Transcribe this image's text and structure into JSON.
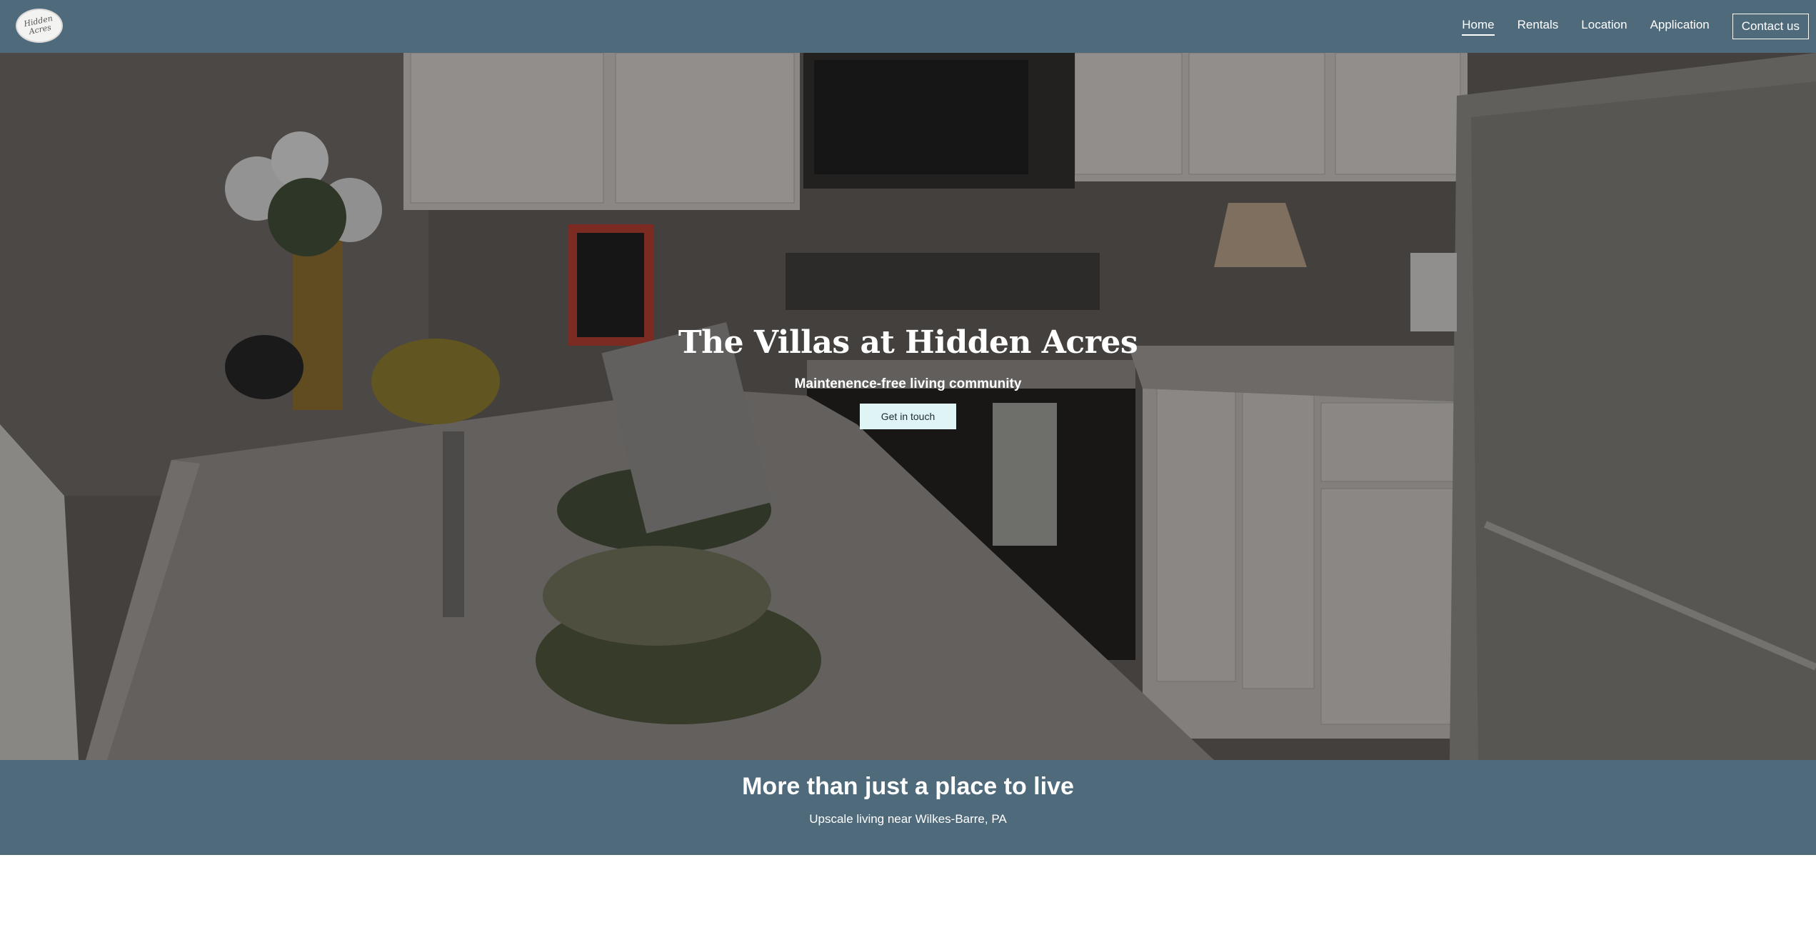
{
  "nav": {
    "logo_text": "Hidden Acres",
    "links": [
      {
        "label": "Home",
        "active": true
      },
      {
        "label": "Rentals",
        "active": false
      },
      {
        "label": "Location",
        "active": false
      },
      {
        "label": "Application",
        "active": false
      }
    ],
    "contact_label": "Contact us"
  },
  "hero": {
    "title": "The Villas at Hidden Acres",
    "subtitle": "Maintenence-free living community",
    "cta_label": "Get in touch",
    "background_image": "kitchen-interior-photo"
  },
  "band": {
    "title": "More than just a place to live",
    "subtitle": "Upscale living near Wilkes-Barre, PA"
  },
  "colors": {
    "nav_bg": "#4f6a7b",
    "cta_bg": "#dff4f4",
    "text": "#ffffff"
  }
}
